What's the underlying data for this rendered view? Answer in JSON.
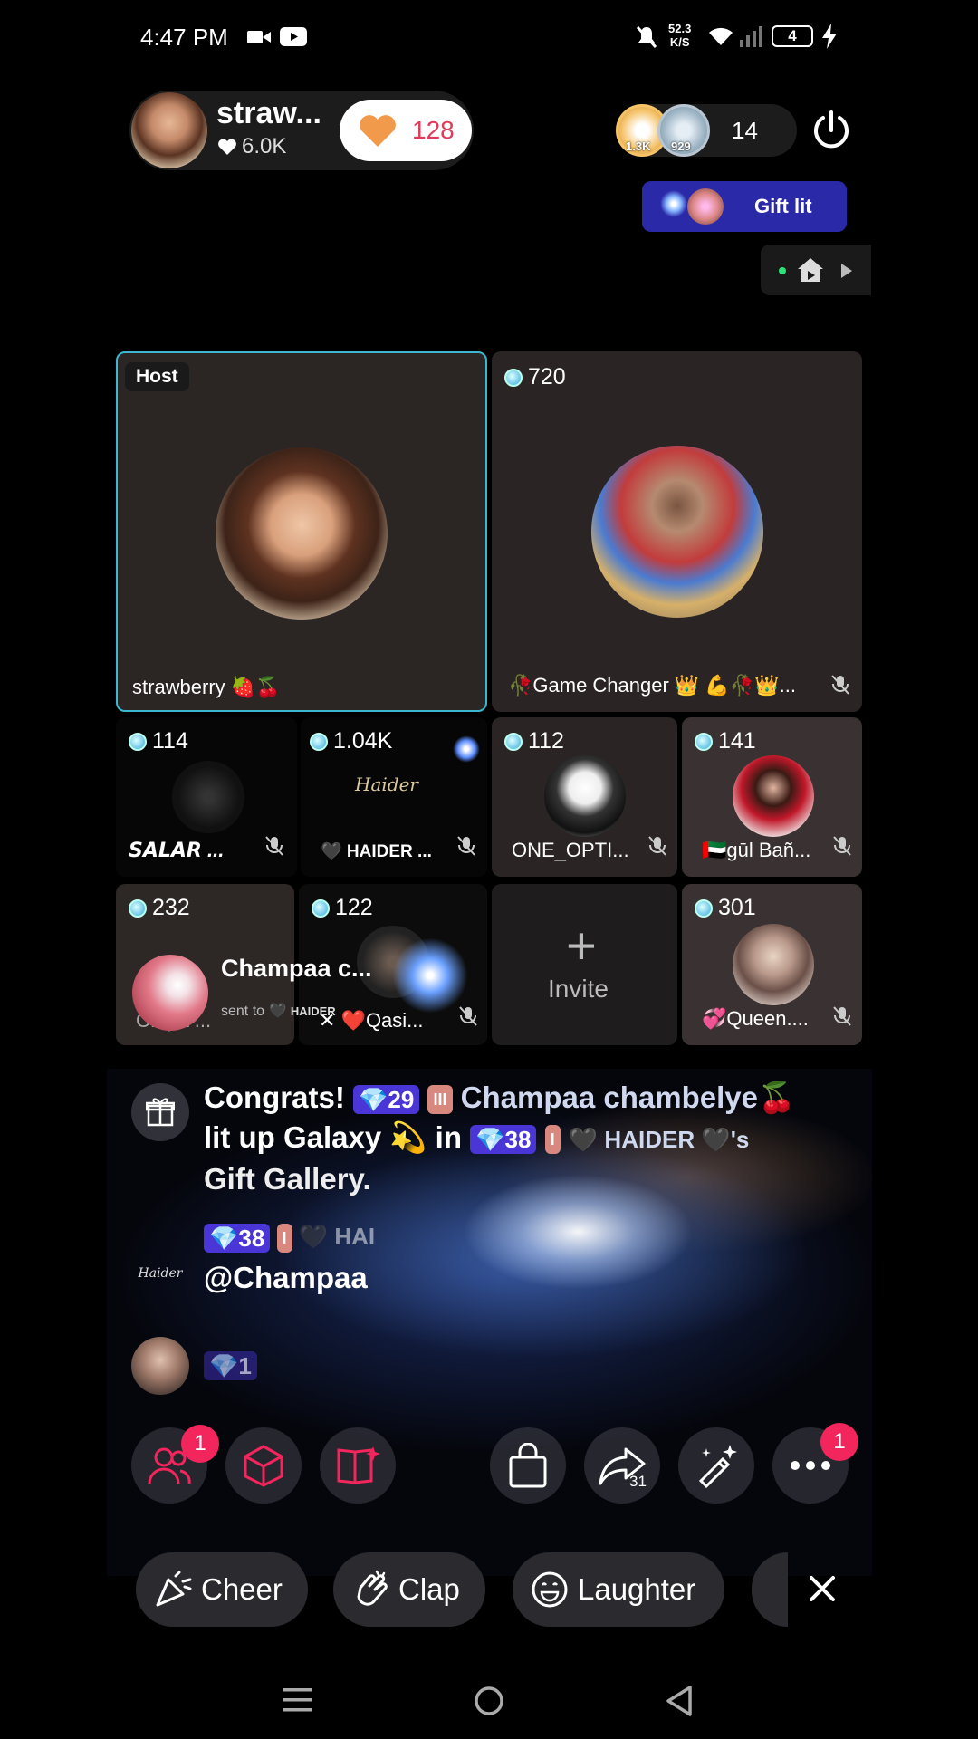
{
  "status_bar": {
    "time": "4:47 PM",
    "net_speed_top": "52.3",
    "net_speed_bottom": "K/S",
    "battery": "4"
  },
  "host_header": {
    "name": "straw...",
    "likes": "6.0K",
    "hearts": "128"
  },
  "viewers": {
    "viewer1_score": "1.3K",
    "viewer2_score": "929",
    "count": "14"
  },
  "gift_lit": {
    "label": "Gift lit"
  },
  "seats": {
    "host": {
      "tag": "Host",
      "name": "strawberry 🍓🍒"
    },
    "seat2": {
      "score": "720",
      "name": "🥀Game Changer 👑 💪🥀👑..."
    },
    "seat3": {
      "score": "114",
      "name": "𝙎𝘼𝙇𝘼𝙍 ..."
    },
    "seat4": {
      "score": "1.04K",
      "name": "🖤 HAIDER ...",
      "logo": "Haider"
    },
    "seat5": {
      "score": "112",
      "name": "ONE_OPTI..."
    },
    "seat6": {
      "score": "141",
      "name": "🇦🇪gūl Bañ..."
    },
    "seat7": {
      "score": "232",
      "name": "C...pa ..."
    },
    "seat8": {
      "score": "122",
      "name": "✕ ❤️Qasi..."
    },
    "invite": {
      "label": "Invite"
    },
    "seat10": {
      "score": "301",
      "name": "💞Queen...."
    }
  },
  "gift_toast": {
    "sender": "Champaa c...",
    "sent_to": "sent to",
    "recipient": "HAIDER"
  },
  "chat": {
    "congrats": {
      "title": "Congrats!",
      "gem_count_1": "29",
      "level_badge_1": "III",
      "user": "Champaa chambelye🍒",
      "text_1": "lit up Galaxy",
      "text_2": "in",
      "gem_count_2": "38",
      "level_badge_2": "I",
      "recipient": "🖤 HAIDER 🖤's",
      "text_3": "Gift Gallery."
    },
    "msg2": {
      "gem_count": "38",
      "level_badge": "I",
      "name": "🖤 HAI",
      "text": "@Champaa",
      "avatar_logo": "Haider"
    },
    "msg3": {
      "gem_count": "1"
    }
  },
  "toolbar": {
    "people_badge": "1",
    "share_count": "31",
    "more_badge": "1"
  },
  "reactions": {
    "cheer": "Cheer",
    "clap": "Clap",
    "laughter": "Laughter"
  },
  "colors": {
    "accent_pink": "#f2255d",
    "gift_lit_bg": "#2a2aa8",
    "host_border": "#39b8d0",
    "gem_blue": "#5b8cff"
  }
}
